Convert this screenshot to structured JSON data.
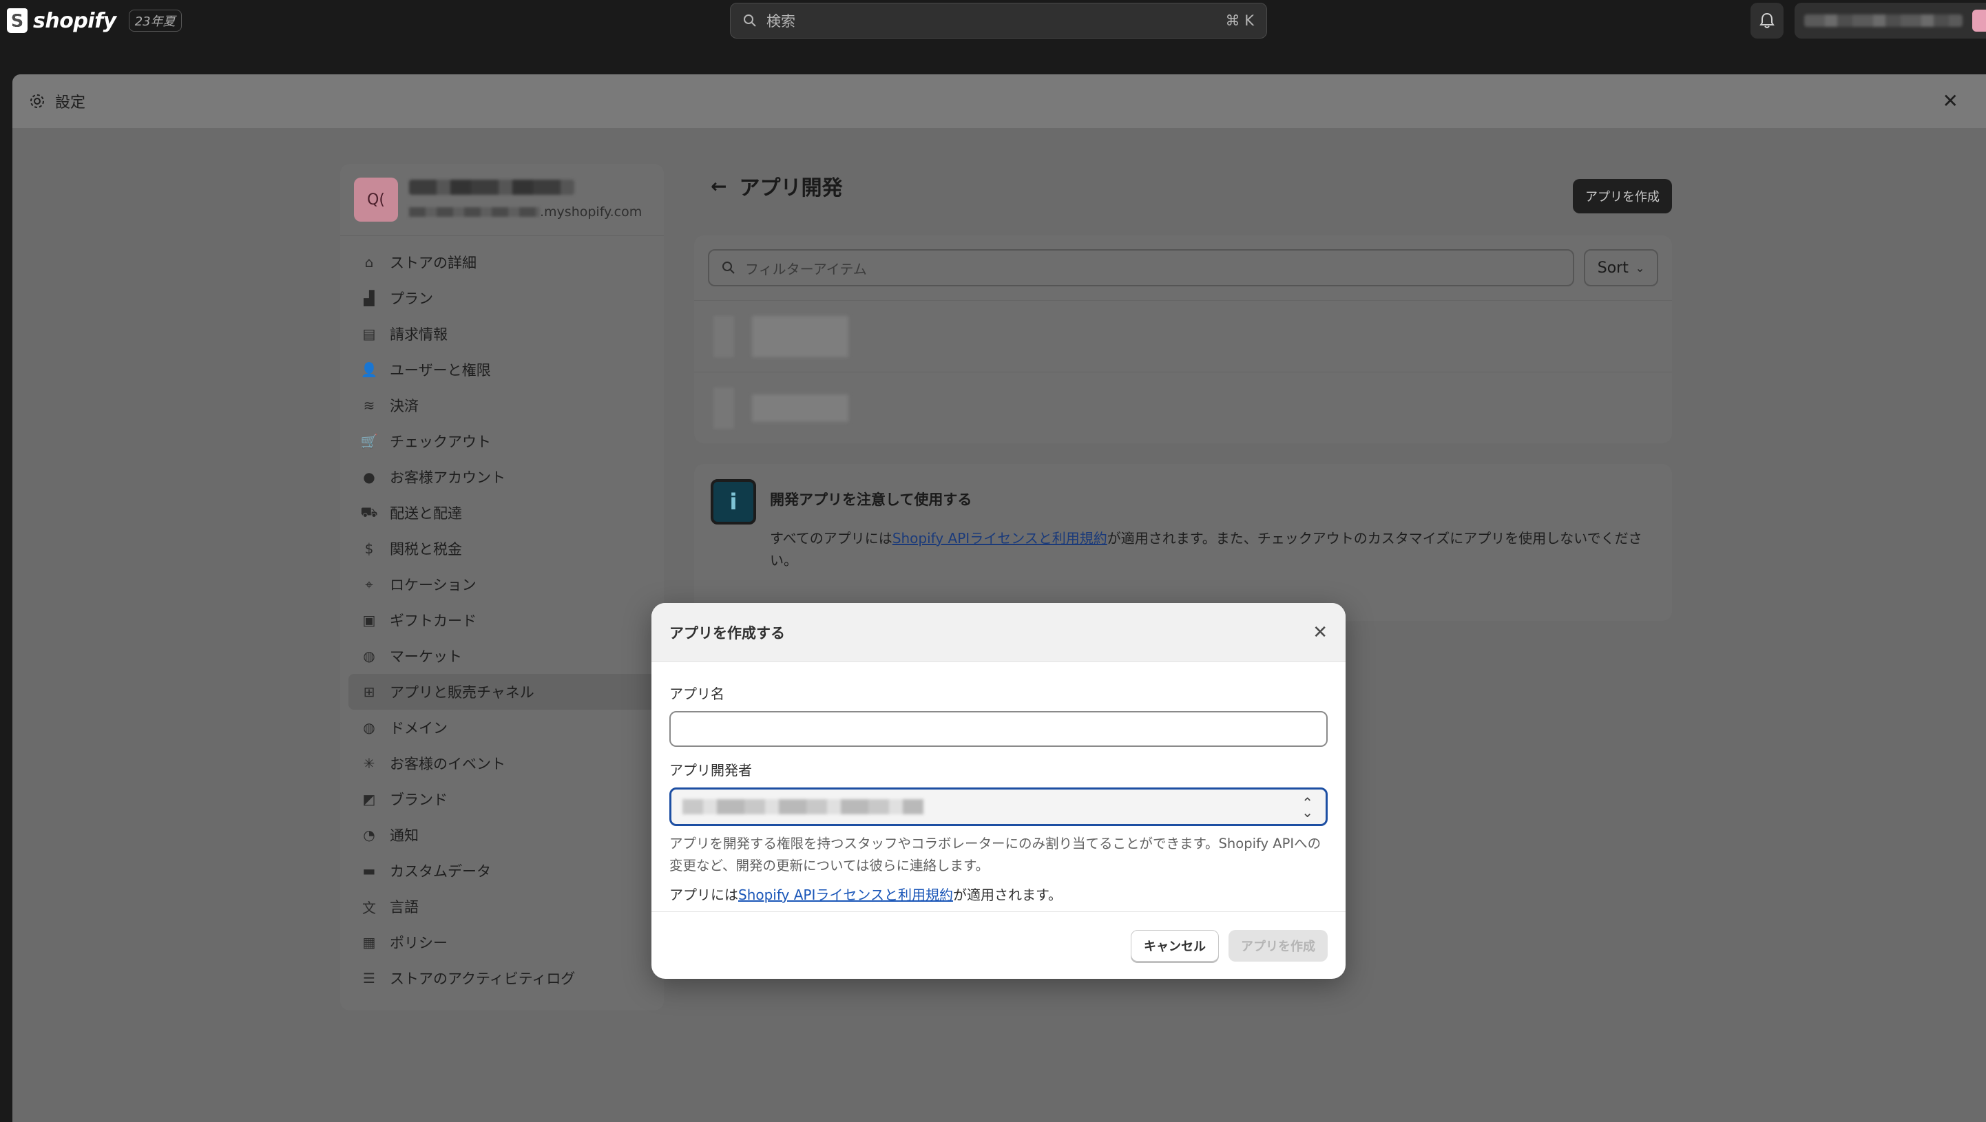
{
  "topbar": {
    "logo_text": "shopify",
    "badge": "23年夏",
    "search_placeholder": "検索",
    "search_shortcut": "⌘ K"
  },
  "settings": {
    "title": "設定"
  },
  "store": {
    "avatar_text": "Q(",
    "domain_suffix": ".myshopify.com"
  },
  "nav": {
    "items": [
      {
        "label": "ストアの詳細",
        "icon": "store-icon"
      },
      {
        "label": "プラン",
        "icon": "plan-icon"
      },
      {
        "label": "請求情報",
        "icon": "billing-icon"
      },
      {
        "label": "ユーザーと権限",
        "icon": "users-icon"
      },
      {
        "label": "決済",
        "icon": "payments-icon"
      },
      {
        "label": "チェックアウト",
        "icon": "cart-icon"
      },
      {
        "label": "お客様アカウント",
        "icon": "person-icon"
      },
      {
        "label": "配送と配達",
        "icon": "truck-icon"
      },
      {
        "label": "関税と税金",
        "icon": "tax-icon"
      },
      {
        "label": "ロケーション",
        "icon": "location-icon"
      },
      {
        "label": "ギフトカード",
        "icon": "gift-card-icon"
      },
      {
        "label": "マーケット",
        "icon": "globe-icon"
      },
      {
        "label": "アプリと販売チャネル",
        "icon": "apps-icon"
      },
      {
        "label": "ドメイン",
        "icon": "domain-icon"
      },
      {
        "label": "お客様のイベント",
        "icon": "events-icon"
      },
      {
        "label": "ブランド",
        "icon": "brand-icon"
      },
      {
        "label": "通知",
        "icon": "bell-icon"
      },
      {
        "label": "カスタムデータ",
        "icon": "data-icon"
      },
      {
        "label": "言語",
        "icon": "language-icon"
      },
      {
        "label": "ポリシー",
        "icon": "policy-icon"
      },
      {
        "label": "ストアのアクティビティログ",
        "icon": "list-icon"
      }
    ]
  },
  "main": {
    "title": "アプリ開発",
    "create_button": "アプリを作成",
    "filter_placeholder": "フィルターアイテム",
    "sort_label": "Sort",
    "info_title": "開発アプリを注意して使用する",
    "info_text_pre": "すべてのアプリには",
    "info_link": "Shopify APIライセンスと利用規約",
    "info_text_post": "が適用されます。また、チェックアウトのカスタマイズにアプリを使用しないでください。"
  },
  "modal": {
    "title": "アプリを作成する",
    "app_name_label": "アプリ名",
    "app_name_value": "",
    "developer_label": "アプリ開発者",
    "help_text": "アプリを開発する権限を持つスタッフやコラボレーターにのみ割り当てることができます。Shopify APIへの変更など、開発の更新については彼らに連絡します。",
    "terms_pre": "アプリには",
    "terms_link": "Shopify APIライセンスと利用規約",
    "terms_post": "が適用されます。",
    "cancel_button": "キャンセル",
    "create_button": "アプリを作成"
  }
}
